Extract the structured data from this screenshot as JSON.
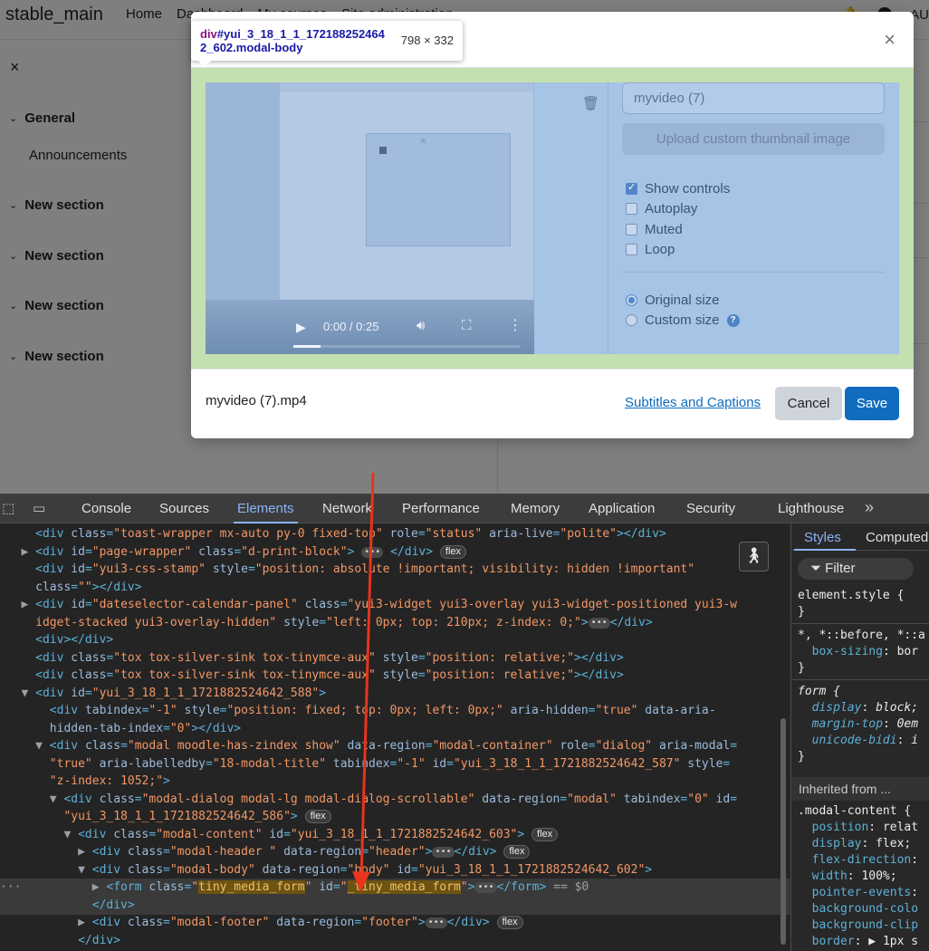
{
  "navbar": {
    "site_name": "stable_main",
    "links": [
      "Home",
      "Dashboard",
      "My courses",
      "Site administration"
    ],
    "user_initials": "AU"
  },
  "drawer": {
    "close_icon": "×",
    "general": "General",
    "announcements": "Announcements",
    "sections": [
      "New section",
      "New section",
      "New section",
      "New section"
    ]
  },
  "inspect_tooltip": {
    "element": "div",
    "selector": "#yui_3_18_1_1_1721882524642_602.modal-body",
    "dimensions": "798 × 332"
  },
  "modal": {
    "close_icon": "×",
    "video": {
      "time": "0:00 / 0:25",
      "progress": 0.12
    },
    "name_value": "myvideo (7)",
    "upload_label": "Upload custom thumbnail image",
    "checkboxes": [
      {
        "label": "Show controls",
        "checked": true
      },
      {
        "label": "Autoplay",
        "checked": false
      },
      {
        "label": "Muted",
        "checked": false
      },
      {
        "label": "Loop",
        "checked": false
      }
    ],
    "radios": [
      {
        "label": "Original size",
        "selected": true
      },
      {
        "label": "Custom size",
        "selected": false
      }
    ],
    "help_glyph": "?",
    "footer": {
      "filename": "myvideo (7).mp4",
      "subtitles_link": "Subtitles and Captions",
      "cancel": "Cancel",
      "save": "Save"
    }
  },
  "devtools": {
    "tabs": [
      "Console",
      "Sources",
      "Elements",
      "Network",
      "Performance",
      "Memory",
      "Application",
      "Security",
      "Lighthouse"
    ],
    "active_tab": "Elements",
    "more": "»",
    "styles_tabs": [
      "Styles",
      "Computed"
    ],
    "filter_label": "Filter",
    "inherited_label": "Inherited from ..."
  },
  "colors": {
    "accent": "#0f6cbf",
    "devtools_active": "#8ab4f8",
    "body_highlight": "#c4dfb0",
    "content_highlight": "#a6c4e6",
    "annotation_arrow": "#e8341c"
  }
}
